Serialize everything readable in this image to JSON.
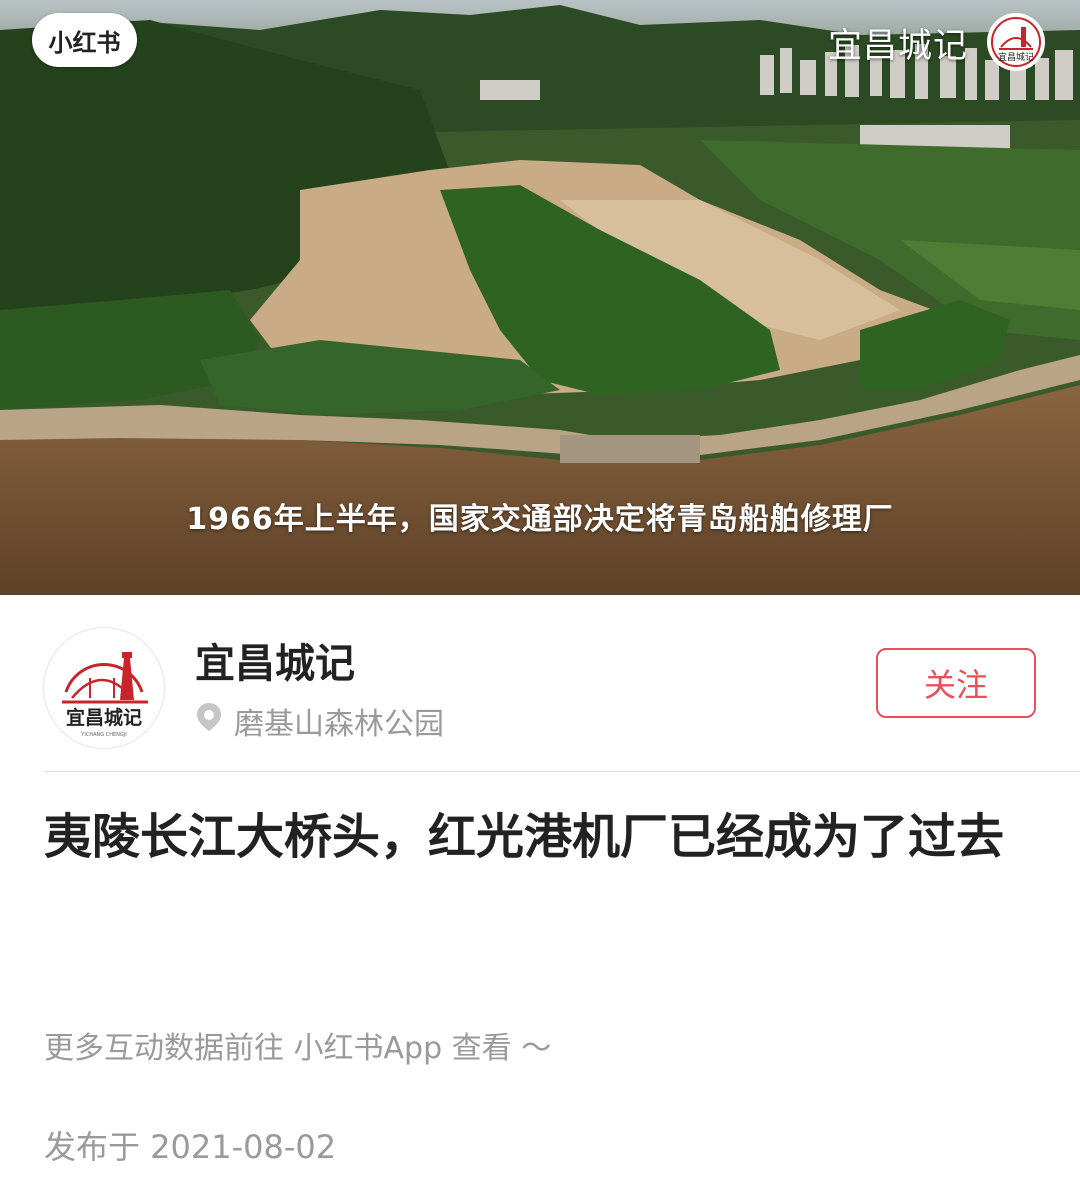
{
  "hero": {
    "app_badge": "小红书",
    "channel_name": "宜昌城记",
    "caption": "1966年上半年，国家交通部决定将青岛船舶修理厂",
    "logo_text": "宜昌城记"
  },
  "author": {
    "name": "宜昌城记",
    "avatar_text": "宜昌城记",
    "avatar_subtext": "YICHANG CHENGJI",
    "location": "磨基山森林公园",
    "follow_label": "关注"
  },
  "post": {
    "title": "夷陵长江大桥头，红光港机厂已经成为了过去",
    "more_hint": "更多互动数据前往 小红书App 查看 ～",
    "published": "发布于 2021-08-02"
  },
  "colors": {
    "accent": "#e8505b",
    "river": "#7a5a3a",
    "forest": "#2f5a22"
  },
  "icons": {
    "location": "location-pin-icon"
  }
}
